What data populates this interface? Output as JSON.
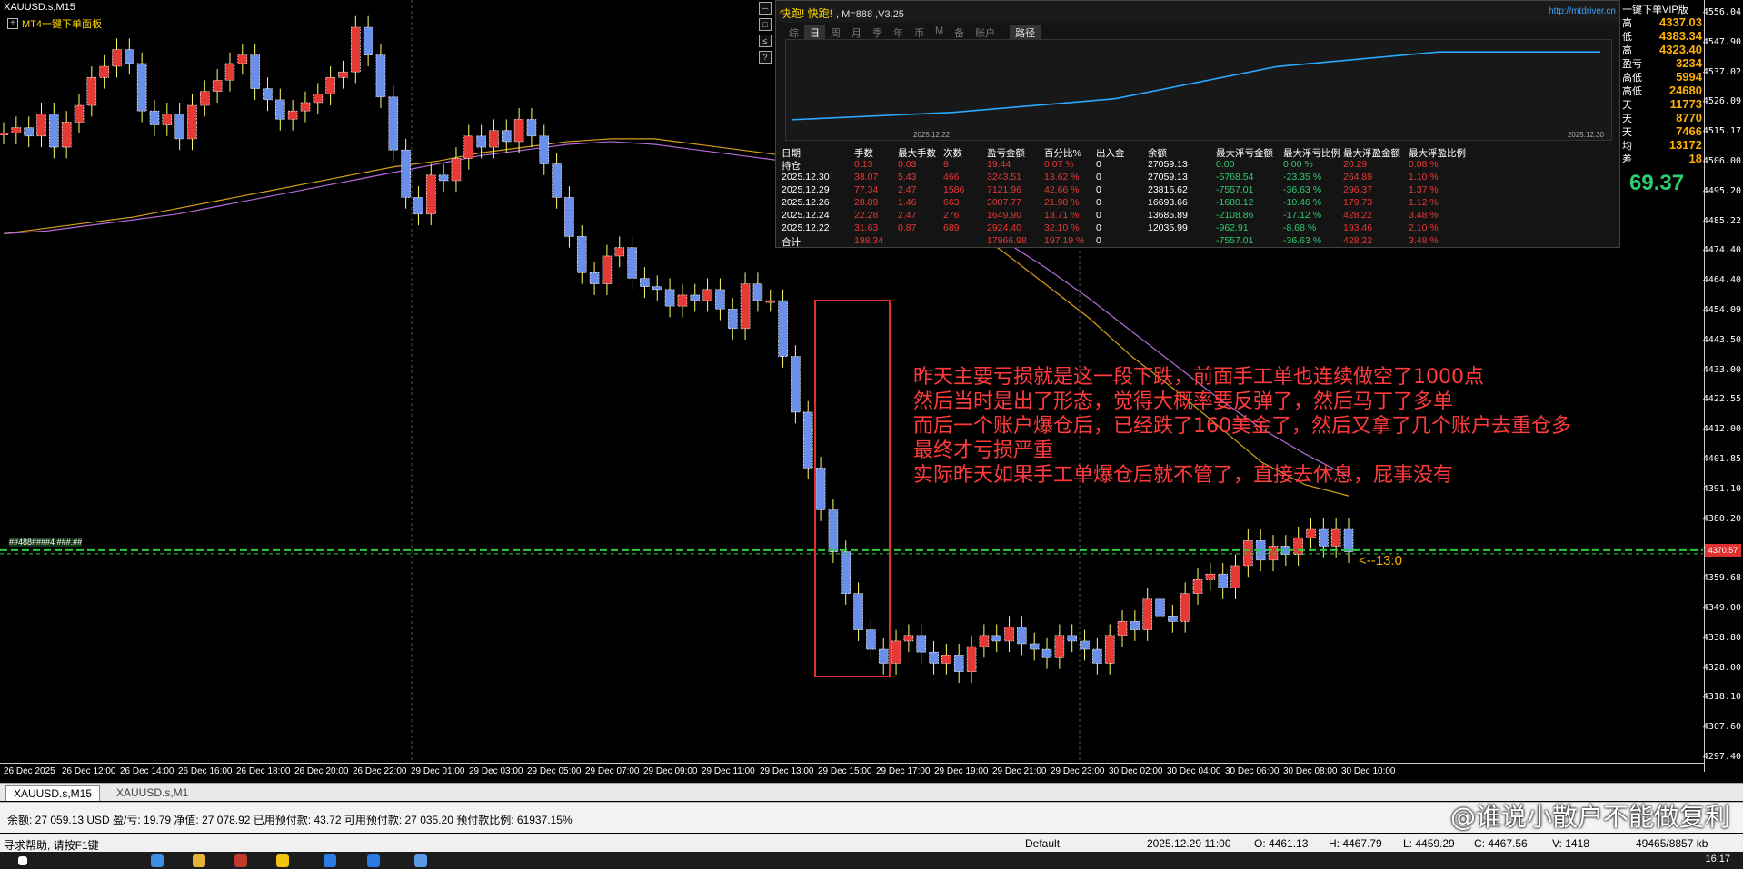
{
  "chart": {
    "title": "XAUUSD.s,M15",
    "panel_button": "MT4一键下单面板",
    "price_labels": [
      "4556.04",
      "4547.90",
      "4537.02",
      "4526.09",
      "4515.17",
      "4506.00",
      "4495.20",
      "4485.22",
      "4474.40",
      "4464.40",
      "4454.09",
      "4443.50",
      "4433.00",
      "4422.55",
      "4412.00",
      "4401.85",
      "4391.10",
      "4380.20",
      "4370.57",
      "4359.68",
      "4349.00",
      "4338.80",
      "4328.00",
      "4318.10",
      "4307.60",
      "4297.40"
    ],
    "time_labels": [
      "26 Dec 2025",
      "26 Dec 12:00",
      "26 Dec 14:00",
      "26 Dec 16:00",
      "26 Dec 18:00",
      "26 Dec 20:00",
      "26 Dec 22:00",
      "29 Dec 01:00",
      "29 Dec 03:00",
      "29 Dec 05:00",
      "29 Dec 07:00",
      "29 Dec 09:00",
      "29 Dec 11:00",
      "29 Dec 13:00",
      "29 Dec 15:00",
      "29 Dec 17:00",
      "29 Dec 19:00",
      "29 Dec 21:00",
      "29 Dec 23:00",
      "30 Dec 02:00",
      "30 Dec 04:00",
      "30 Dec 06:00",
      "30 Dec 08:00",
      "30 Dec 10:00"
    ],
    "current_price_tag": "4370.57",
    "level_tag": "<--13:0",
    "left_mini_tag": "##488####4 ###.##",
    "annotation_lines": [
      "昨天主要亏损就是这一段下跌，前面手工单也连续做空了1000点",
      "然后当时是出了形态，觉得大概率要反弹了，然后马丁了多单",
      "而后一个账户爆仓后，已经跌了160美金了，然后又拿了几个账户去重仓多",
      "最终才亏损严重",
      "实际昨天如果手工单爆仓后就不管了，直接去休息，屁事没有"
    ],
    "price_path": [
      4520,
      4522,
      4519,
      4527,
      4515,
      4524,
      4530,
      4540,
      4544,
      4550,
      4545,
      4528,
      4523,
      4527,
      4518,
      4530,
      4535,
      4539,
      4545,
      4548,
      4536,
      4532,
      4525,
      4528,
      4531,
      4534,
      4540,
      4542,
      4558,
      4548,
      4533,
      4514,
      4497,
      4491,
      4505,
      4503,
      4511,
      4519,
      4515,
      4521,
      4517,
      4525,
      4519,
      4509,
      4497,
      4483,
      4470,
      4466,
      4476,
      4479,
      4468,
      4465,
      4464,
      4458,
      4462,
      4460,
      4464,
      4457,
      4450,
      4466,
      4460,
      4460,
      4440,
      4420,
      4400,
      4385,
      4370,
      4355,
      4342,
      4335,
      4330,
      4338,
      4340,
      4334,
      4330,
      4333,
      4327,
      4336,
      4340,
      4338,
      4343,
      4337,
      4335,
      4332,
      4340,
      4338,
      4335,
      4330,
      4340,
      4345,
      4342,
      4353,
      4347,
      4345,
      4355,
      4360,
      4362,
      4357,
      4365,
      4374,
      4367,
      4372,
      4369,
      4375,
      4378,
      4372,
      4378,
      4370
    ],
    "ma_yellow": [
      4484,
      4486,
      4488,
      4490,
      4493,
      4496,
      4499,
      4502,
      4505,
      4508,
      4510,
      4513,
      4515,
      4517,
      4518,
      4518,
      4516,
      4514,
      4512,
      4509,
      4503,
      4496,
      4488,
      4478,
      4466,
      4454,
      4440,
      4428,
      4415,
      4402,
      4394,
      4390
    ],
    "ma_purple": [
      4484,
      4485,
      4487,
      4489,
      4491,
      4494,
      4497,
      4500,
      4503,
      4506,
      4509,
      4512,
      4514,
      4516,
      4517,
      4516,
      4514,
      4512,
      4510,
      4507,
      4502,
      4496,
      4490,
      4482,
      4472,
      4461,
      4449,
      4437,
      4425,
      4414,
      4405,
      4397
    ],
    "level_price": 4370.57,
    "y_range": [
      4295,
      4558
    ],
    "colors": {
      "bull": "#e53935",
      "bear": "#6a8fe8",
      "wick": "#ffff66",
      "level": "#2ecc40",
      "ma1": "#d4a017",
      "ma2": "#b36bd6"
    }
  },
  "stats_panel": {
    "title": "快跑! 快跑!",
    "version": ", M=888 ,V3.25",
    "url": "http://mtdriver.cn",
    "tabs": [
      "综",
      "日",
      "周",
      "月",
      "季",
      "年",
      "币",
      "M",
      "备",
      "账户"
    ],
    "active_tab": "日",
    "route_tab": "路径",
    "graph_start_date": "2025.12.22",
    "graph_end_date": "2025.12.30",
    "equity_curve": [
      12035.99,
      13685.89,
      16693.66,
      23815.62,
      27059.13,
      27059.13
    ],
    "headers": [
      "日期",
      "手数",
      "最大手数",
      "次数",
      "盈亏金额",
      "百分比%",
      "出入金",
      "余额",
      "最大浮亏金额",
      "最大浮亏比例",
      "最大浮盈金额",
      "最大浮盈比例"
    ],
    "rows": [
      [
        "持仓",
        "0.13",
        "0.03",
        "8",
        "19.44",
        "0.07 %",
        "0",
        "27059.13",
        "0.00",
        "0.00 %",
        "20.29",
        "0.08 %"
      ],
      [
        "2025.12.30",
        "38.07",
        "5.43",
        "466",
        "3243.51",
        "13.62 %",
        "0",
        "27059.13",
        "-5768.54",
        "-23.35 %",
        "264.89",
        "1.10 %"
      ],
      [
        "2025.12.29",
        "77.34",
        "2.47",
        "1586",
        "7121.96",
        "42.66 %",
        "0",
        "23815.62",
        "-7557.01",
        "-36.63 %",
        "296.37",
        "1.37 %"
      ],
      [
        "2025.12.26",
        "28.89",
        "1.46",
        "663",
        "3007.77",
        "21.98 %",
        "0",
        "16693.66",
        "-1680.12",
        "-10.46 %",
        "179.73",
        "1.12 %"
      ],
      [
        "2025.12.24",
        "22.28",
        "2.47",
        "276",
        "1649.90",
        "13.71 %",
        "0",
        "13685.89",
        "-2108.86",
        "-17.12 %",
        "428.22",
        "3.48 %"
      ],
      [
        "2025.12.22",
        "31.63",
        "0.87",
        "689",
        "2924.40",
        "32.10 %",
        "0",
        "12035.99",
        "-962.91",
        "-8.68 %",
        "193.46",
        "2.10 %"
      ],
      [
        "合计",
        "198.34",
        "",
        "",
        "17966.98",
        "197.19 %",
        "0",
        "",
        "-7557.01",
        "-36.63 %",
        "428.22",
        "3.48 %"
      ]
    ],
    "side_buttons": [
      "─",
      "□",
      "≤",
      "?"
    ]
  },
  "right_info": {
    "items": [
      {
        "label": "一键下单VIP版",
        "value": ""
      },
      {
        "label": "高",
        "value": "4337.03"
      },
      {
        "label": "低",
        "value": "4383.34"
      },
      {
        "label": "高",
        "value": "4323.40"
      },
      {
        "label": "盈亏",
        "value": "3234"
      },
      {
        "label": "高低",
        "value": "5994"
      },
      {
        "label": "高低",
        "value": "24680"
      },
      {
        "label": "天",
        "value": "11773"
      },
      {
        "label": "天",
        "value": "8770"
      },
      {
        "label": "天",
        "value": "7466"
      },
      {
        "label": "均",
        "value": "13172"
      },
      {
        "label": "差",
        "value": "18"
      }
    ],
    "big_value": "69.37"
  },
  "symbol_tabs": [
    "XAUUSD.s,M15",
    "XAUUSD.s,M1"
  ],
  "account_bar": "余额: 27 059.13 USD  盈/亏: 19.79  净值: 27 078.92  已用预付款: 43.72  可用预付款: 27 035.20  预付款比例: 61937.15%",
  "watermark": "@谁说小散户不能做复利",
  "status_bar": {
    "help": "寻求帮助, 请按F1键",
    "profile": "Default",
    "datetime": "2025.12.29 11:00",
    "open": "O: 4461.13",
    "high": "H: 4467.79",
    "low": "L: 4459.29",
    "close": "C: 4467.56",
    "volume": "V: 1418",
    "traffic": "49465/8857 kb"
  },
  "taskbar": {
    "time": "16:17"
  }
}
